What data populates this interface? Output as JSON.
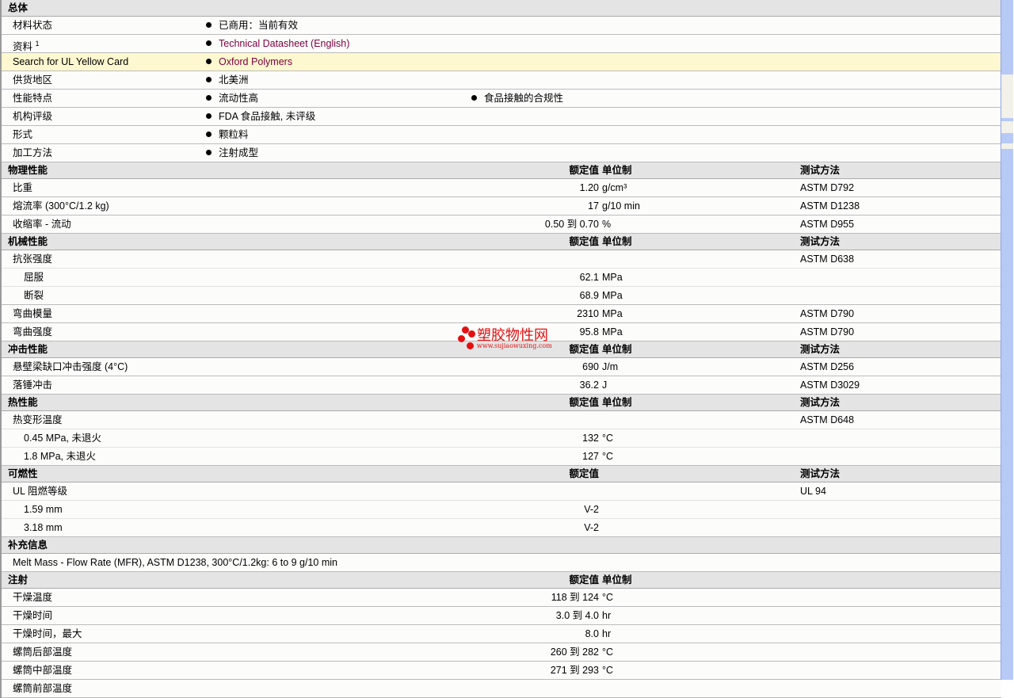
{
  "general": {
    "title": "总体",
    "rows": [
      {
        "label": "材料状态",
        "items": [
          "已商用：当前有效"
        ]
      },
      {
        "label": "资料",
        "sup": "1",
        "items": [
          "Technical Datasheet (English)"
        ],
        "link": true
      },
      {
        "label": "Search for UL Yellow Card",
        "items": [
          "Oxford Polymers"
        ],
        "link": true,
        "highlight": true
      },
      {
        "label": "供货地区",
        "items": [
          "北美洲"
        ]
      },
      {
        "label": "性能特点",
        "items": [
          "流动性高",
          "食品接触的合规性"
        ]
      },
      {
        "label": "机构评级",
        "items": [
          "FDA 食品接触, 未评级"
        ]
      },
      {
        "label": "形式",
        "items": [
          "颗粒料"
        ]
      },
      {
        "label": "加工方法",
        "items": [
          "注射成型"
        ]
      }
    ]
  },
  "sections": [
    {
      "title": "物理性能",
      "h_value": "额定值",
      "h_unit": "单位制",
      "h_method": "测试方法",
      "rows": [
        {
          "label": "比重",
          "value": "1.20",
          "unit": "g/cm³",
          "method": "ASTM D792"
        },
        {
          "label": "熔流率 (300°C/1.2 kg)",
          "value": "17",
          "unit": "g/10 min",
          "method": "ASTM D1238"
        },
        {
          "label": "收缩率 - 流动",
          "value": "0.50 到 0.70",
          "unit": "%",
          "method": "ASTM D955"
        }
      ]
    },
    {
      "title": "机械性能",
      "h_value": "额定值",
      "h_unit": "单位制",
      "h_method": "测试方法",
      "rows": [
        {
          "label": "抗张强度",
          "method": "ASTM D638",
          "sub": true
        },
        {
          "label": "屈服",
          "value": "62.1",
          "unit": "MPa",
          "indent": true,
          "sub": true
        },
        {
          "label": "断裂",
          "value": "68.9",
          "unit": "MPa",
          "indent": true
        },
        {
          "label": "弯曲模量",
          "value": "2310",
          "unit": "MPa",
          "method": "ASTM D790"
        },
        {
          "label": "弯曲强度",
          "value": "95.8",
          "unit": "MPa",
          "method": "ASTM D790"
        }
      ]
    },
    {
      "title": "冲击性能",
      "h_value": "额定值",
      "h_unit": "单位制",
      "h_method": "测试方法",
      "rows": [
        {
          "label": "悬壁梁缺口冲击强度 (4°C)",
          "value": "690",
          "unit": "J/m",
          "method": "ASTM D256"
        },
        {
          "label": "落锤冲击",
          "value": "36.2",
          "unit": "J",
          "method": "ASTM D3029"
        }
      ]
    },
    {
      "title": "热性能",
      "h_value": "额定值",
      "h_unit": "单位制",
      "h_method": "测试方法",
      "rows": [
        {
          "label": "热变形温度",
          "method": "ASTM D648",
          "sub": true
        },
        {
          "label": "0.45 MPa, 未退火",
          "value": "132",
          "unit": "°C",
          "indent": true,
          "sub": true
        },
        {
          "label": "1.8 MPa, 未退火",
          "value": "127",
          "unit": "°C",
          "indent": true
        }
      ]
    },
    {
      "title": "可燃性",
      "h_value": "额定值",
      "h_method": "测试方法",
      "rows": [
        {
          "label": "UL 阻燃等级",
          "method": "UL 94",
          "sub": true
        },
        {
          "label": "1.59 mm",
          "value": "V-2",
          "indent": true,
          "sub": true
        },
        {
          "label": "3.18 mm",
          "value": "V-2",
          "indent": true
        }
      ]
    },
    {
      "title": "补充信息",
      "rows": [
        {
          "label": "Melt Mass - Flow Rate (MFR), ASTM D1238, 300°C/1.2kg: 6 to 9 g/10 min"
        }
      ]
    },
    {
      "title": "注射",
      "h_value": "额定值",
      "h_unit": "单位制",
      "rows": [
        {
          "label": "干燥温度",
          "value": "118 到 124",
          "unit": "°C"
        },
        {
          "label": "干燥时间",
          "value": "3.0 到 4.0",
          "unit": "hr"
        },
        {
          "label": "干燥时间，最大",
          "value": "8.0",
          "unit": "hr"
        },
        {
          "label": "螺筒后部温度",
          "value": "260 到 282",
          "unit": "°C"
        },
        {
          "label": "螺筒中部温度",
          "value": "271 到 293",
          "unit": "°C"
        },
        {
          "label": "螺筒前部温度"
        }
      ]
    }
  ],
  "watermark": {
    "text": "塑胶物性网",
    "url": "www.sujiaowuxing.com"
  }
}
